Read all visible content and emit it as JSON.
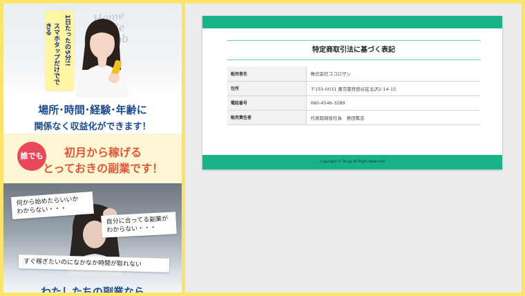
{
  "lp": {
    "hero": {
      "script_lines": [
        "Home",
        "Side",
        "Job"
      ],
      "badge_line1": "1日たったの5分!!",
      "badge_line2": "スマホタップだけでできる"
    },
    "tagline": {
      "line1": "場所･時間･経験･年齢に",
      "line2": "関係なく収益化ができます！"
    },
    "promo": {
      "badge": "誰でも",
      "line1": "初月から稼げる",
      "line2": "とっておきの副業です！"
    },
    "worries": {
      "bubble1": "何から始めたらいいか\nわからない・・・",
      "bubble2": "自分に合ってる副業が\nわからない・・・",
      "bubble3": "すぐ稼ぎたいのになかなか時間が取れない",
      "title": "わたしたちの副業なら"
    }
  },
  "legal": {
    "title": "特定商取引法に基づく表記",
    "rows": [
      {
        "label": "販売者名",
        "value": "株式会社ココロザシ"
      },
      {
        "label": "住所",
        "value": "〒155-0031 東京都世田谷区北沢2-14-15"
      },
      {
        "label": "電話番号",
        "value": "080-4546-3289"
      },
      {
        "label": "販売責任者",
        "value": "代表取締役社長　島田篤志"
      }
    ],
    "footer": "Copyright © To-up All Right Reserved"
  },
  "colors": {
    "frame": "#fde36a",
    "accent_green": "#17b386",
    "navy_text": "#1c4b8c",
    "promo_orange": "#e0573a",
    "promo_badge": "#e8485a"
  }
}
